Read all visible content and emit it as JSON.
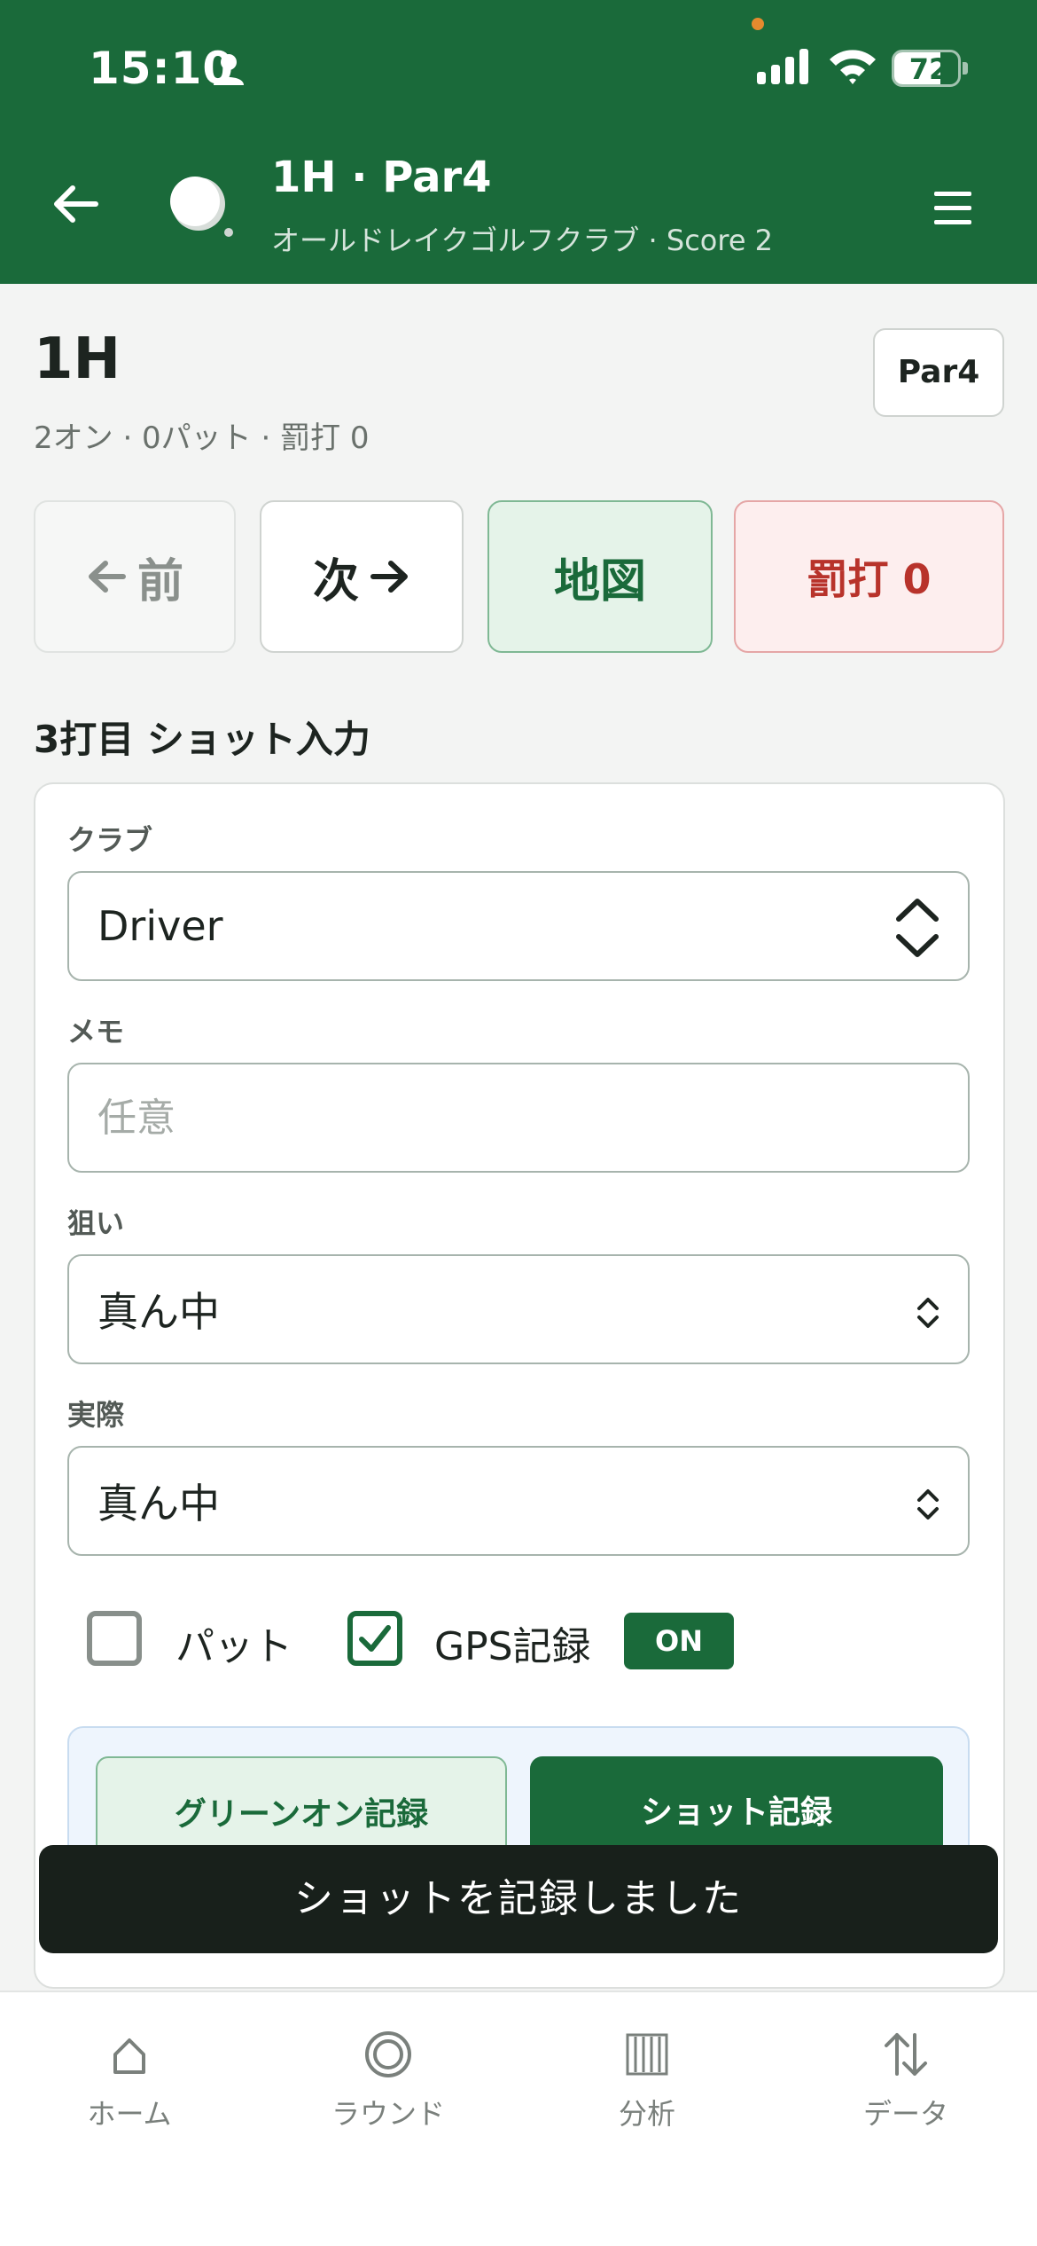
{
  "status_bar": {
    "time": "15:10",
    "battery": "72",
    "battery_level": 0.72
  },
  "header": {
    "title": "1H · Par4",
    "subtitle": "オールドレイクゴルフクラブ · Score 2"
  },
  "hole": {
    "name": "1H",
    "meta": "2オン · 0パット · 罰打 0",
    "par_badge": "Par4"
  },
  "nav_buttons": {
    "prev": "前",
    "next": "次",
    "map": "地図",
    "penalty": "罰打 0"
  },
  "section_title": "3打目 ショット入力",
  "form": {
    "club_label": "クラブ",
    "club_value": "Driver",
    "memo_label": "メモ",
    "memo_placeholder": "任意",
    "target_label": "狙い",
    "target_value": "真ん中",
    "actual_label": "実際",
    "actual_value": "真ん中",
    "putt_label": "パット",
    "putt_checked": false,
    "gps_label": "GPS記録",
    "gps_checked": true,
    "gps_badge": "ON"
  },
  "actions": {
    "green_on": "グリーンオン記録",
    "record_shot": "ショット記録"
  },
  "toast": "ショットを記録しました",
  "tabs": [
    {
      "label": "ホーム",
      "icon": "home-icon"
    },
    {
      "label": "ラウンド",
      "icon": "round-icon"
    },
    {
      "label": "分析",
      "icon": "analysis-icon"
    },
    {
      "label": "データ",
      "icon": "data-sort-icon"
    }
  ],
  "colors": {
    "brand": "#1a6a3a",
    "danger": "#b8332b",
    "toast": "#18201b"
  }
}
